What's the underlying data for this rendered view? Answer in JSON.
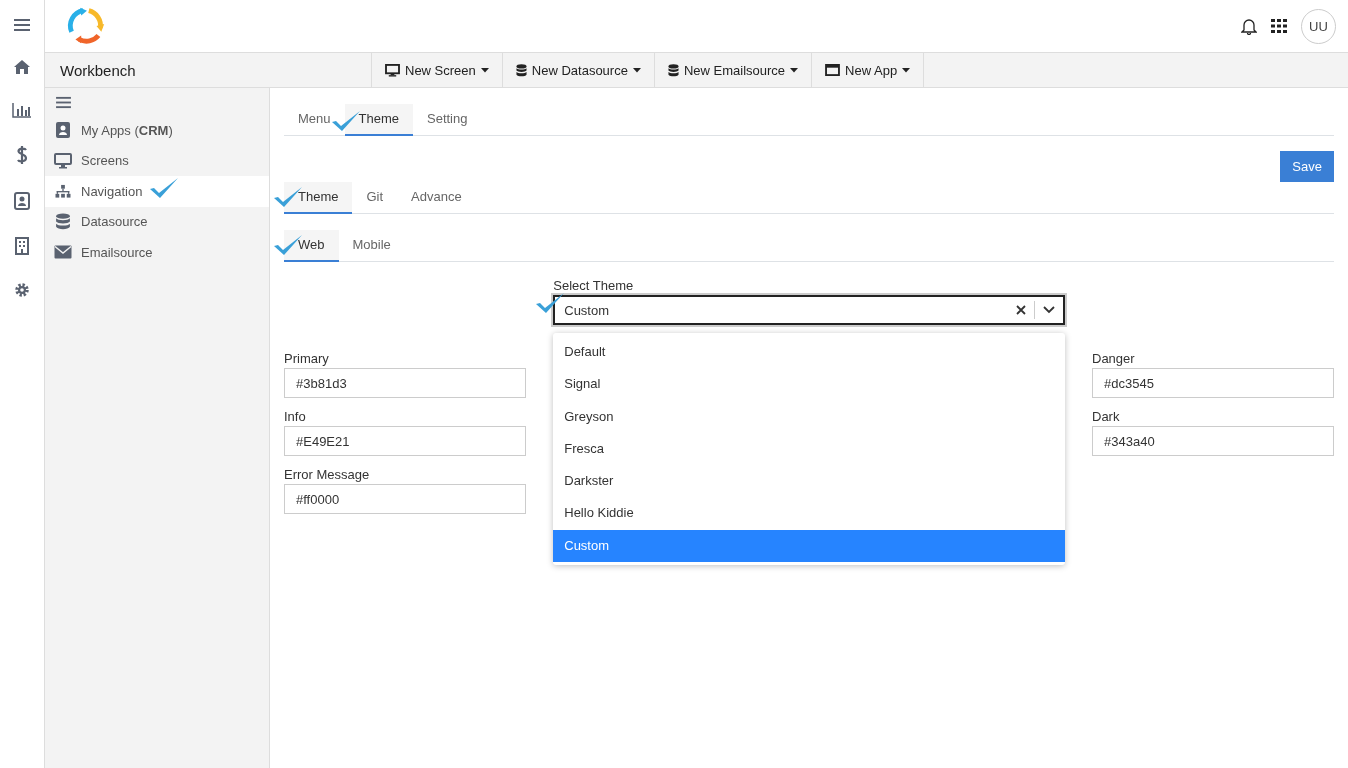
{
  "header": {
    "avatar": "UU"
  },
  "workbench": {
    "title": "Workbench"
  },
  "toolbar": [
    {
      "label": "New Screen"
    },
    {
      "label": "New Datasource"
    },
    {
      "label": "New Emailsource"
    },
    {
      "label": "New App"
    }
  ],
  "sidebar": {
    "items": [
      {
        "label": "My Apps (**CRM**)",
        "selected": false,
        "ticked": false
      },
      {
        "label": "Screens",
        "selected": false,
        "ticked": false
      },
      {
        "label": "Navigation",
        "selected": true,
        "ticked": true
      },
      {
        "label": "Datasource",
        "selected": false,
        "ticked": false
      },
      {
        "label": "Emailsource",
        "selected": false,
        "ticked": false
      }
    ]
  },
  "tabs": [
    {
      "label": "Menu",
      "selected": false,
      "ticked": false
    },
    {
      "label": "Theme",
      "selected": true,
      "ticked": true
    },
    {
      "label": "Setting",
      "selected": false,
      "ticked": false
    }
  ],
  "save_button": "Save",
  "sub_tabs": [
    {
      "label": "Theme",
      "selected": true,
      "ticked": true
    },
    {
      "label": "Git",
      "selected": false,
      "ticked": false
    },
    {
      "label": "Advance",
      "selected": false,
      "ticked": false
    }
  ],
  "platform_tabs": [
    {
      "label": "Web",
      "selected": true,
      "ticked": true
    },
    {
      "label": "Mobile",
      "selected": false,
      "ticked": false
    }
  ],
  "select_theme": {
    "label": "Select Theme",
    "value": "Custom",
    "ticked": true,
    "options": [
      {
        "label": "Default",
        "selected": false
      },
      {
        "label": "Signal",
        "selected": false
      },
      {
        "label": "Greyson",
        "selected": false
      },
      {
        "label": "Fresca",
        "selected": false
      },
      {
        "label": "Darkster",
        "selected": false
      },
      {
        "label": "Hello Kiddie",
        "selected": false
      },
      {
        "label": "Custom",
        "selected": true
      }
    ]
  },
  "fields_left": [
    {
      "label": "Primary",
      "value": "#3b81d3"
    },
    {
      "label": "Info",
      "value": "#E49E21"
    },
    {
      "label": "Error Message",
      "value": "#ff0000"
    }
  ],
  "fields_right": [
    {
      "label": "Danger",
      "value": "#dc3545"
    },
    {
      "label": "Dark",
      "value": "#343a40"
    }
  ]
}
